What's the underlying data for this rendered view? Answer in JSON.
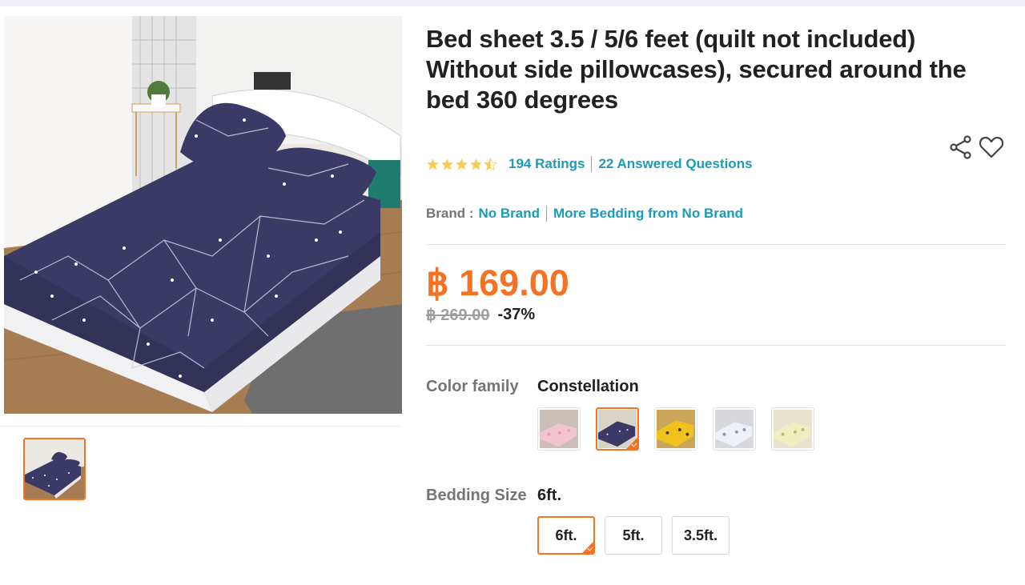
{
  "product": {
    "title": "Bed sheet 3.5 / 5/6 feet (quilt not included) Without side pillowcases), secured around the bed 360 degrees",
    "rating_stars": 4.5,
    "ratings_text": "194 Ratings",
    "questions_text": "22 Answered Questions",
    "brand_label": "Brand :",
    "brand_name": "No Brand",
    "more_from_brand": "More Bedding from No Brand"
  },
  "price": {
    "current": "฿ 169.00",
    "original": "฿ 269.00",
    "discount": "-37%"
  },
  "color_family": {
    "label": "Color family",
    "selected": "Constellation",
    "options_count": 5,
    "selected_index": 1
  },
  "bedding_size": {
    "label": "Bedding Size",
    "selected": "6ft.",
    "options": [
      "6ft.",
      "5ft.",
      "3.5ft."
    ]
  },
  "icons": {
    "share": "share-icon",
    "wishlist": "heart-icon",
    "star": "star-icon"
  },
  "colors": {
    "accent": "#f57224",
    "link": "#1a9cb7",
    "star": "#faca51",
    "muted": "#757575"
  }
}
